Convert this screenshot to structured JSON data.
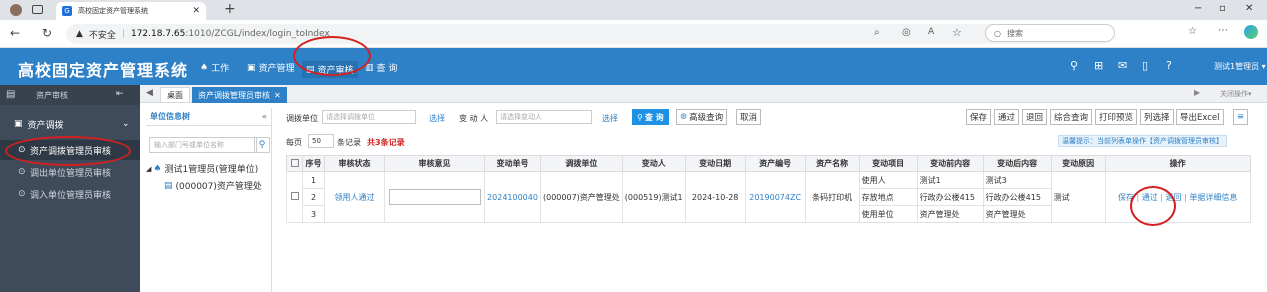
{
  "browser": {
    "tab_title": "高校固定资产管理系统",
    "tab_icon": "G",
    "new_tab": "+",
    "warning": "不安全",
    "url_host": "172.18.7.65",
    "url_path": ":1010/ZCGL/index/login_toIndex",
    "search_placeholder": "搜索",
    "window_controls": [
      "−",
      "▫",
      "✕"
    ]
  },
  "app": {
    "title": "高校固定资产管理系统",
    "menus": [
      {
        "icon": "home-icon",
        "label": "工作"
      },
      {
        "icon": "asset-icon",
        "label": "资产管理"
      },
      {
        "icon": "audit-icon",
        "label": "资产审核"
      },
      {
        "icon": "query-icon",
        "label": "查 询"
      }
    ],
    "user": "测试1管理员 ▾",
    "colors": {
      "header": "#2e81c6",
      "sidebar": "#3f4a5a",
      "accent": "#1e90e6",
      "alert": "#d32020"
    }
  },
  "sidebar": {
    "head": "资产审核",
    "group": "资产调拨",
    "items": [
      "资产调拨管理员审核",
      "调出单位管理员审核",
      "调入单位管理员审核"
    ]
  },
  "page_tabs": {
    "desk": "桌面",
    "current": "资产调拨管理员审核",
    "close_ops": "关闭操作▾"
  },
  "tree": {
    "title": "单位信息树",
    "search_placeholder": "输入部门号或单位名称",
    "root": "测试1管理员(管理单位)",
    "child": "(000007)资产管理处"
  },
  "filter": {
    "unit_label": "调拨单位",
    "unit_placeholder": "请选择调拨单位",
    "unit_select": "选择",
    "person_label": "变 动 人",
    "person_placeholder": "请选择变动人",
    "person_select": "选择",
    "query": "查 询",
    "adv_query": "高级查询",
    "cancel": "取消"
  },
  "toolbar": [
    "保存",
    "通过",
    "退回",
    "综合查询",
    "打印预览",
    "列选择",
    "导出Excel",
    "≡"
  ],
  "paging": {
    "prefix": "每页",
    "size": "50",
    "suffix": "条记录",
    "total": "共3条记录",
    "tip": "温馨提示：当前列表单操作【资产调拨管理员审核】"
  },
  "table": {
    "headers": [
      "序号",
      "审核状态",
      "审核意见",
      "变动单号",
      "调拨单位",
      "变动人",
      "变动日期",
      "资产编号",
      "资产名称",
      "变动项目",
      "变动前内容",
      "变动后内容",
      "变动原因",
      "操作"
    ],
    "row": {
      "status": "领用人通过",
      "bill_no": "2024100040",
      "unit": "(000007)资产管理处",
      "person": "(000519)测试1",
      "date": "2024-10-28",
      "asset_no": "20190074ZC",
      "asset_name": "条码打印机",
      "reason": "测试",
      "sub": [
        {
          "no": "1",
          "item": "使用人",
          "before": "测试1",
          "after": "测试3"
        },
        {
          "no": "2",
          "item": "存放地点",
          "before": "行政办公楼415",
          "after": "行政办公楼415"
        },
        {
          "no": "3",
          "item": "使用单位",
          "before": "资产管理处",
          "after": "资产管理处"
        }
      ],
      "ops": [
        "保存",
        "通过",
        "退回",
        "单据详细信息"
      ]
    }
  }
}
